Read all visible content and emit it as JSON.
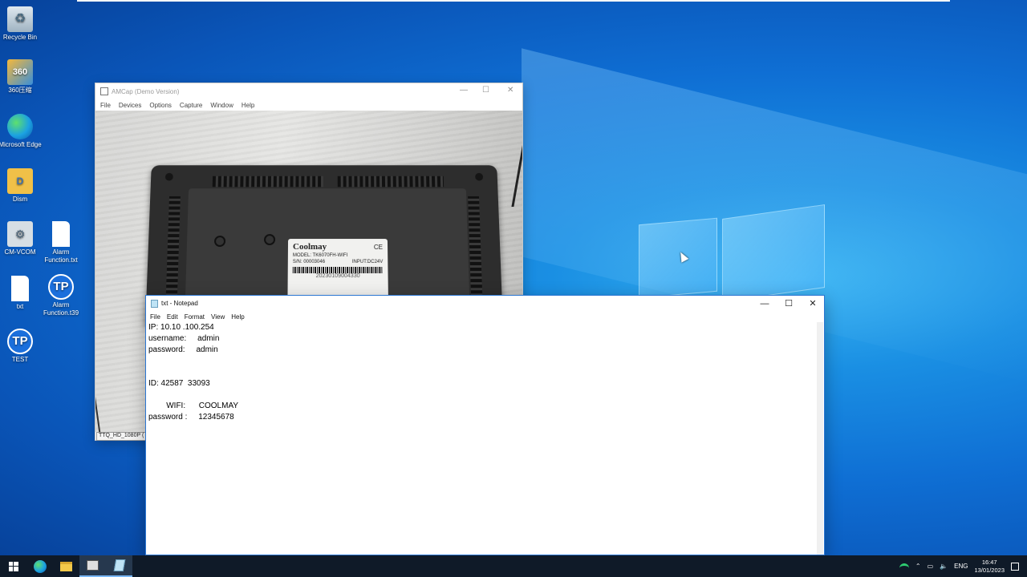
{
  "desktop": {
    "icons": [
      {
        "label": "Recycle Bin",
        "glyph": "♻"
      },
      {
        "label": "360压缩",
        "glyph": "360"
      },
      {
        "label": "Microsoft Edge",
        "glyph": ""
      },
      {
        "label": "Dism",
        "glyph": "D"
      },
      {
        "label": "CM-VCOM",
        "glyph": "⚙"
      },
      {
        "label": "Alarm Function.txt",
        "glyph": ""
      },
      {
        "label": "txt",
        "glyph": ""
      },
      {
        "label": "Alarm Function.t39",
        "glyph": "TP"
      },
      {
        "label": "TEST",
        "glyph": "TP"
      }
    ]
  },
  "amcap": {
    "title": "AMCap (Demo Version)",
    "controls": {
      "minimize": "—",
      "maximize": "☐",
      "close": "✕"
    },
    "menu": [
      "File",
      "Devices",
      "Options",
      "Capture",
      "Window",
      "Help"
    ],
    "status": "TTQ_HD_1080P (",
    "device_label": {
      "brand": "Coolmay",
      "mark": "CE",
      "model": "MODEL: TK6070FH-WIFI",
      "sn": "S/N: 00003046",
      "input": "INPUT:DC24V",
      "barcode_number": "20230109004330"
    }
  },
  "notepad": {
    "title": "txt - Notepad",
    "controls": {
      "minimize": "—",
      "maximize": "☐",
      "close": "✕"
    },
    "menu": [
      "File",
      "Edit",
      "Format",
      "View",
      "Help"
    ],
    "content": "IP: 10.10 .100.254\nusername:     admin\npassword:     admin\n\n\nID: 42587  33093\n\n        WIFI:      COOLMAY\npassword :     12345678"
  },
  "taskbar": {
    "apps": [
      "start",
      "edge",
      "file-explorer",
      "amcap",
      "notepad"
    ],
    "tray": {
      "language": "ENG",
      "time": "16:47",
      "date": "13/01/2023"
    }
  },
  "colors": {
    "desktop_blue": "#0f6fd4",
    "taskbar": "#0f1a28",
    "notepad_border": "#2b76d2"
  }
}
